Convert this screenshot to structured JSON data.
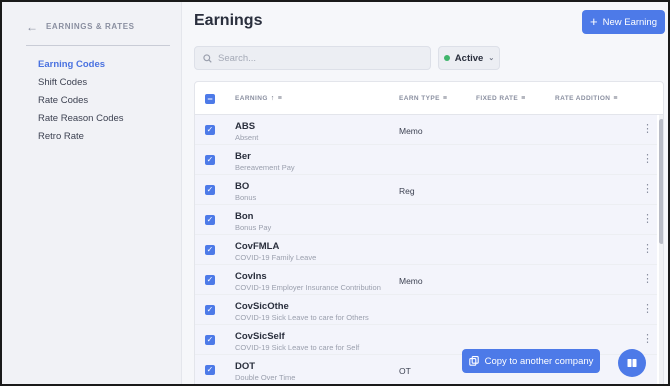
{
  "sidebar": {
    "back_label": "EARNINGS & RATES",
    "items": [
      {
        "label": "Earning Codes",
        "active": true
      },
      {
        "label": "Shift Codes"
      },
      {
        "label": "Rate Codes"
      },
      {
        "label": "Rate Reason Codes"
      },
      {
        "label": "Retro Rate"
      }
    ]
  },
  "header": {
    "title": "Earnings",
    "new_button": "New Earning",
    "search_placeholder": "Search...",
    "filter_label": "Active"
  },
  "table": {
    "columns": [
      "EARNING",
      "EARN TYPE",
      "FIXED RATE",
      "RATE ADDITION"
    ],
    "rows": [
      {
        "name": "ABS",
        "desc": "Absent",
        "earn_type": "Memo"
      },
      {
        "name": "Ber",
        "desc": "Bereavement Pay",
        "earn_type": ""
      },
      {
        "name": "BO",
        "desc": "Bonus",
        "earn_type": "Reg"
      },
      {
        "name": "Bon",
        "desc": "Bonus Pay",
        "earn_type": ""
      },
      {
        "name": "CovFMLA",
        "desc": "COVID-19 Family Leave",
        "earn_type": ""
      },
      {
        "name": "CovIns",
        "desc": "COVID-19 Employer Insurance Contribution",
        "earn_type": "Memo"
      },
      {
        "name": "CovSicOthe",
        "desc": "COVID-19 Sick Leave to care for Others",
        "earn_type": ""
      },
      {
        "name": "CovSicSelf",
        "desc": "COVID-19 Sick Leave to care for Self",
        "earn_type": ""
      },
      {
        "name": "DOT",
        "desc": "Double Over Time",
        "earn_type": "OT"
      }
    ]
  },
  "footer": {
    "copy_button": "Copy to another company"
  },
  "colors": {
    "accent": "#4d7ae8",
    "active_nav": "#4a72e0",
    "status_active": "#3fb56b"
  },
  "icons": [
    "back-arrow-icon",
    "plus-icon",
    "search-icon",
    "chevron-down-icon",
    "sort-up-icon",
    "filter-icon",
    "kebab-menu-icon",
    "copy-icon",
    "book-icon"
  ]
}
